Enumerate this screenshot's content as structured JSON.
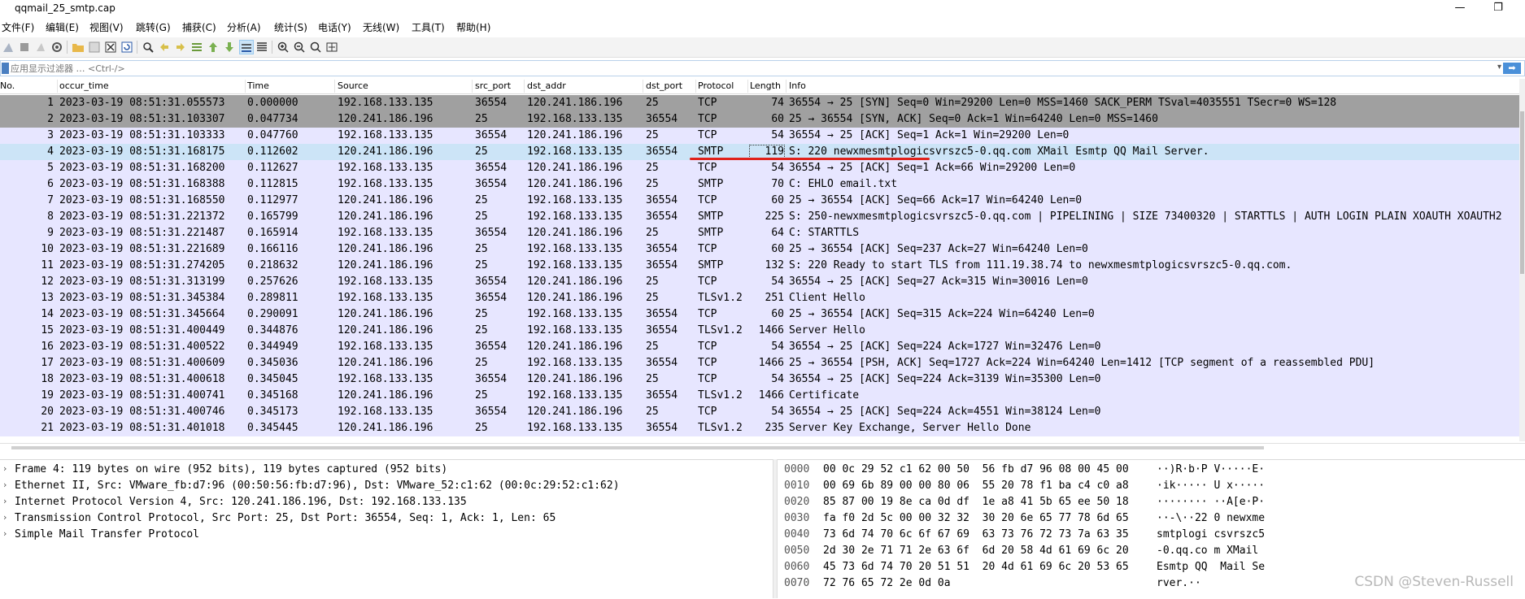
{
  "window": {
    "title": "qqmail_25_smtp.cap",
    "minimize": "—",
    "restore": "❐"
  },
  "menu": [
    "文件(F)",
    "编辑(E)",
    "视图(V)",
    "跳转(G)",
    "捕获(C)",
    "分析(A)",
    "统计(S)",
    "电话(Y)",
    "无线(W)",
    "工具(T)",
    "帮助(H)"
  ],
  "toolbar": {
    "icons": [
      "shark-fin-start-icon",
      "stop-icon",
      "restart-icon",
      "options-gear-icon",
      "open-folder-icon",
      "save-icon",
      "close-file-icon",
      "reload-icon",
      "find-icon",
      "go-back-icon",
      "go-forward-icon",
      "go-to-packet-icon",
      "go-first-icon",
      "go-last-icon",
      "auto-scroll-icon",
      "colorize-icon",
      "zoom-in-icon",
      "zoom-out-icon",
      "zoom-normal-icon",
      "resize-columns-icon"
    ]
  },
  "filter": {
    "placeholder": "应用显示过滤器 … <Ctrl-/>",
    "apply": "➡"
  },
  "columns": [
    "No.",
    "occur_time",
    "Time",
    "Source",
    "src_port",
    "dst_addr",
    "dst_port",
    "Protocol",
    "Length",
    "Info"
  ],
  "packets": [
    {
      "no": "1",
      "occur": "2023-03-19 08:51:31.055573",
      "time": "0.000000",
      "src": "192.168.133.135",
      "sport": "36554",
      "dst": "120.241.186.196",
      "dport": "25",
      "proto": "TCP",
      "len": "74",
      "info": "36554 → 25 [SYN] Seq=0 Win=29200 Len=0 MSS=1460 SACK_PERM TSval=4035551 TSecr=0 WS=128",
      "style": "gray"
    },
    {
      "no": "2",
      "occur": "2023-03-19 08:51:31.103307",
      "time": "0.047734",
      "src": "120.241.186.196",
      "sport": "25",
      "dst": "192.168.133.135",
      "dport": "36554",
      "proto": "TCP",
      "len": "60",
      "info": "25 → 36554 [SYN, ACK] Seq=0 Ack=1 Win=64240 Len=0 MSS=1460",
      "style": "gray"
    },
    {
      "no": "3",
      "occur": "2023-03-19 08:51:31.103333",
      "time": "0.047760",
      "src": "192.168.133.135",
      "sport": "36554",
      "dst": "120.241.186.196",
      "dport": "25",
      "proto": "TCP",
      "len": "54",
      "info": "36554 → 25 [ACK] Seq=1 Ack=1 Win=29200 Len=0",
      "style": "lav"
    },
    {
      "no": "4",
      "occur": "2023-03-19 08:51:31.168175",
      "time": "0.112602",
      "src": "120.241.186.196",
      "sport": "25",
      "dst": "192.168.133.135",
      "dport": "36554",
      "proto": "SMTP",
      "len": "119",
      "info": "S: 220 newxmesmtplogicsvrszc5-0.qq.com XMail Esmtp QQ Mail Server.",
      "style": "sel"
    },
    {
      "no": "5",
      "occur": "2023-03-19 08:51:31.168200",
      "time": "0.112627",
      "src": "192.168.133.135",
      "sport": "36554",
      "dst": "120.241.186.196",
      "dport": "25",
      "proto": "TCP",
      "len": "54",
      "info": "36554 → 25 [ACK] Seq=1 Ack=66 Win=29200 Len=0",
      "style": "lav"
    },
    {
      "no": "6",
      "occur": "2023-03-19 08:51:31.168388",
      "time": "0.112815",
      "src": "192.168.133.135",
      "sport": "36554",
      "dst": "120.241.186.196",
      "dport": "25",
      "proto": "SMTP",
      "len": "70",
      "info": "C: EHLO email.txt",
      "style": "lav"
    },
    {
      "no": "7",
      "occur": "2023-03-19 08:51:31.168550",
      "time": "0.112977",
      "src": "120.241.186.196",
      "sport": "25",
      "dst": "192.168.133.135",
      "dport": "36554",
      "proto": "TCP",
      "len": "60",
      "info": "25 → 36554 [ACK] Seq=66 Ack=17 Win=64240 Len=0",
      "style": "lav"
    },
    {
      "no": "8",
      "occur": "2023-03-19 08:51:31.221372",
      "time": "0.165799",
      "src": "120.241.186.196",
      "sport": "25",
      "dst": "192.168.133.135",
      "dport": "36554",
      "proto": "SMTP",
      "len": "225",
      "info": "S: 250-newxmesmtplogicsvrszc5-0.qq.com | PIPELINING | SIZE 73400320 | STARTTLS | AUTH LOGIN PLAIN XOAUTH XOAUTH2",
      "style": "lav"
    },
    {
      "no": "9",
      "occur": "2023-03-19 08:51:31.221487",
      "time": "0.165914",
      "src": "192.168.133.135",
      "sport": "36554",
      "dst": "120.241.186.196",
      "dport": "25",
      "proto": "SMTP",
      "len": "64",
      "info": "C: STARTTLS",
      "style": "lav"
    },
    {
      "no": "10",
      "occur": "2023-03-19 08:51:31.221689",
      "time": "0.166116",
      "src": "120.241.186.196",
      "sport": "25",
      "dst": "192.168.133.135",
      "dport": "36554",
      "proto": "TCP",
      "len": "60",
      "info": "25 → 36554 [ACK] Seq=237 Ack=27 Win=64240 Len=0",
      "style": "lav"
    },
    {
      "no": "11",
      "occur": "2023-03-19 08:51:31.274205",
      "time": "0.218632",
      "src": "120.241.186.196",
      "sport": "25",
      "dst": "192.168.133.135",
      "dport": "36554",
      "proto": "SMTP",
      "len": "132",
      "info": "S: 220 Ready to start TLS from 111.19.38.74 to newxmesmtplogicsvrszc5-0.qq.com.",
      "style": "lav"
    },
    {
      "no": "12",
      "occur": "2023-03-19 08:51:31.313199",
      "time": "0.257626",
      "src": "192.168.133.135",
      "sport": "36554",
      "dst": "120.241.186.196",
      "dport": "25",
      "proto": "TCP",
      "len": "54",
      "info": "36554 → 25 [ACK] Seq=27 Ack=315 Win=30016 Len=0",
      "style": "lav"
    },
    {
      "no": "13",
      "occur": "2023-03-19 08:51:31.345384",
      "time": "0.289811",
      "src": "192.168.133.135",
      "sport": "36554",
      "dst": "120.241.186.196",
      "dport": "25",
      "proto": "TLSv1.2",
      "len": "251",
      "info": "Client Hello",
      "style": "lav"
    },
    {
      "no": "14",
      "occur": "2023-03-19 08:51:31.345664",
      "time": "0.290091",
      "src": "120.241.186.196",
      "sport": "25",
      "dst": "192.168.133.135",
      "dport": "36554",
      "proto": "TCP",
      "len": "60",
      "info": "25 → 36554 [ACK] Seq=315 Ack=224 Win=64240 Len=0",
      "style": "lav"
    },
    {
      "no": "15",
      "occur": "2023-03-19 08:51:31.400449",
      "time": "0.344876",
      "src": "120.241.186.196",
      "sport": "25",
      "dst": "192.168.133.135",
      "dport": "36554",
      "proto": "TLSv1.2",
      "len": "1466",
      "info": "Server Hello",
      "style": "lav"
    },
    {
      "no": "16",
      "occur": "2023-03-19 08:51:31.400522",
      "time": "0.344949",
      "src": "192.168.133.135",
      "sport": "36554",
      "dst": "120.241.186.196",
      "dport": "25",
      "proto": "TCP",
      "len": "54",
      "info": "36554 → 25 [ACK] Seq=224 Ack=1727 Win=32476 Len=0",
      "style": "lav"
    },
    {
      "no": "17",
      "occur": "2023-03-19 08:51:31.400609",
      "time": "0.345036",
      "src": "120.241.186.196",
      "sport": "25",
      "dst": "192.168.133.135",
      "dport": "36554",
      "proto": "TCP",
      "len": "1466",
      "info": "25 → 36554 [PSH, ACK] Seq=1727 Ack=224 Win=64240 Len=1412 [TCP segment of a reassembled PDU]",
      "style": "lav"
    },
    {
      "no": "18",
      "occur": "2023-03-19 08:51:31.400618",
      "time": "0.345045",
      "src": "192.168.133.135",
      "sport": "36554",
      "dst": "120.241.186.196",
      "dport": "25",
      "proto": "TCP",
      "len": "54",
      "info": "36554 → 25 [ACK] Seq=224 Ack=3139 Win=35300 Len=0",
      "style": "lav"
    },
    {
      "no": "19",
      "occur": "2023-03-19 08:51:31.400741",
      "time": "0.345168",
      "src": "120.241.186.196",
      "sport": "25",
      "dst": "192.168.133.135",
      "dport": "36554",
      "proto": "TLSv1.2",
      "len": "1466",
      "info": "Certificate",
      "style": "lav"
    },
    {
      "no": "20",
      "occur": "2023-03-19 08:51:31.400746",
      "time": "0.345173",
      "src": "192.168.133.135",
      "sport": "36554",
      "dst": "120.241.186.196",
      "dport": "25",
      "proto": "TCP",
      "len": "54",
      "info": "36554 → 25 [ACK] Seq=224 Ack=4551 Win=38124 Len=0",
      "style": "lav"
    },
    {
      "no": "21",
      "occur": "2023-03-19 08:51:31.401018",
      "time": "0.345445",
      "src": "120.241.186.196",
      "sport": "25",
      "dst": "192.168.133.135",
      "dport": "36554",
      "proto": "TLSv1.2",
      "len": "235",
      "info": "Server Key Exchange, Server Hello Done",
      "style": "lav"
    }
  ],
  "details": [
    "Frame 4: 119 bytes on wire (952 bits), 119 bytes captured (952 bits)",
    "Ethernet II, Src: VMware_fb:d7:96 (00:50:56:fb:d7:96), Dst: VMware_52:c1:62 (00:0c:29:52:c1:62)",
    "Internet Protocol Version 4, Src: 120.241.186.196, Dst: 192.168.133.135",
    "Transmission Control Protocol, Src Port: 25, Dst Port: 36554, Seq: 1, Ack: 1, Len: 65",
    "Simple Mail Transfer Protocol"
  ],
  "bytes": [
    {
      "off": "0000",
      "hex": "00 0c 29 52 c1 62 00 50  56 fb d7 96 08 00 45 00",
      "ascii": "··)R·b·P V·····E·"
    },
    {
      "off": "0010",
      "hex": "00 69 6b 89 00 00 80 06  55 20 78 f1 ba c4 c0 a8",
      "ascii": "·ik····· U x·····"
    },
    {
      "off": "0020",
      "hex": "85 87 00 19 8e ca 0d df  1e a8 41 5b 65 ee 50 18",
      "ascii": "········ ··A[e·P·"
    },
    {
      "off": "0030",
      "hex": "fa f0 2d 5c 00 00 32 32  30 20 6e 65 77 78 6d 65",
      "ascii": "··-\\··22 0 newxme"
    },
    {
      "off": "0040",
      "hex": "73 6d 74 70 6c 6f 67 69  63 73 76 72 73 7a 63 35",
      "ascii": "smtplogi csvrszc5"
    },
    {
      "off": "0050",
      "hex": "2d 30 2e 71 71 2e 63 6f  6d 20 58 4d 61 69 6c 20",
      "ascii": "-0.qq.co m XMail "
    },
    {
      "off": "0060",
      "hex": "45 73 6d 74 70 20 51 51  20 4d 61 69 6c 20 53 65",
      "ascii": "Esmtp QQ  Mail Se"
    },
    {
      "off": "0070",
      "hex": "72 76 65 72 2e 0d 0a",
      "ascii": "rver.··"
    }
  ],
  "watermark": "CSDN @Steven-Russell",
  "colors": {
    "gray": "#a0a0a0",
    "lav": "#e7e6ff",
    "sel": "#cce4f7",
    "annotation": "#e0221b"
  }
}
